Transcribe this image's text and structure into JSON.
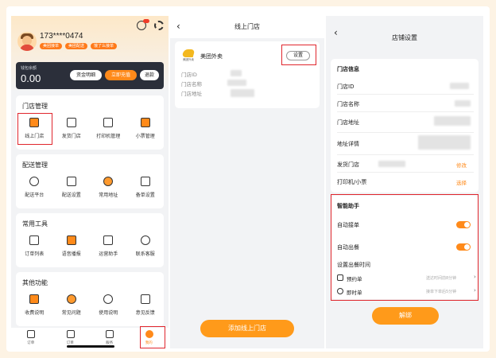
{
  "left_panel": {
    "phone": "173****0474",
    "badges": [
      "美团接单",
      "美团配送",
      "饿了么接单"
    ],
    "balance_label": "钱包余额",
    "balance_value": "0.00",
    "buttons": {
      "detail": "资金明细",
      "recharge": "立即充值",
      "refund": "退款"
    },
    "sections": [
      {
        "title": "门店管理",
        "items": [
          "线上门店",
          "发货门店",
          "打印机管理",
          "小票管理"
        ]
      },
      {
        "title": "配送管理",
        "items": [
          "配送平台",
          "配送设置",
          "常用地址",
          "备单设置"
        ]
      },
      {
        "title": "常用工具",
        "items": [
          "订单列表",
          "语音播报",
          "运营助手",
          "联系客服"
        ]
      },
      {
        "title": "其他功能",
        "items": [
          "收费说明",
          "常见问题",
          "使用说明",
          "意见反馈"
        ]
      }
    ],
    "tabs": [
      "订单",
      "订单",
      "服务",
      "我的"
    ]
  },
  "middle_panel": {
    "title": "线上门店",
    "store_logo_text": "美团外卖",
    "store_name": "美团外卖",
    "setting_button": "设置",
    "fields": [
      "门店ID",
      "门店名称",
      "门店地址"
    ],
    "add_button": "添加线上门店"
  },
  "right_panel": {
    "title": "店铺设置",
    "info_section": "门店信息",
    "info_rows": [
      "门店ID",
      "门店名称",
      "门店地址",
      "地址详情",
      "发货门店",
      "打印机/小票"
    ],
    "modify_link": "修改",
    "select_link": "选择",
    "smart_section": "智能助手",
    "auto_accept": "自动接单",
    "auto_deliver": "自动出餐",
    "deliver_time_label": "设置出餐时间",
    "preorder_label": "预约单",
    "preorder_value": "送达时间前8分钟",
    "instant_label": "即时单",
    "instant_value": "接单下单后5分钟",
    "unbind_button": "解绑"
  },
  "colors": {
    "accent": "#ff8a1a",
    "highlight": "#e0262d",
    "card_dark": "#2b2f3a"
  }
}
